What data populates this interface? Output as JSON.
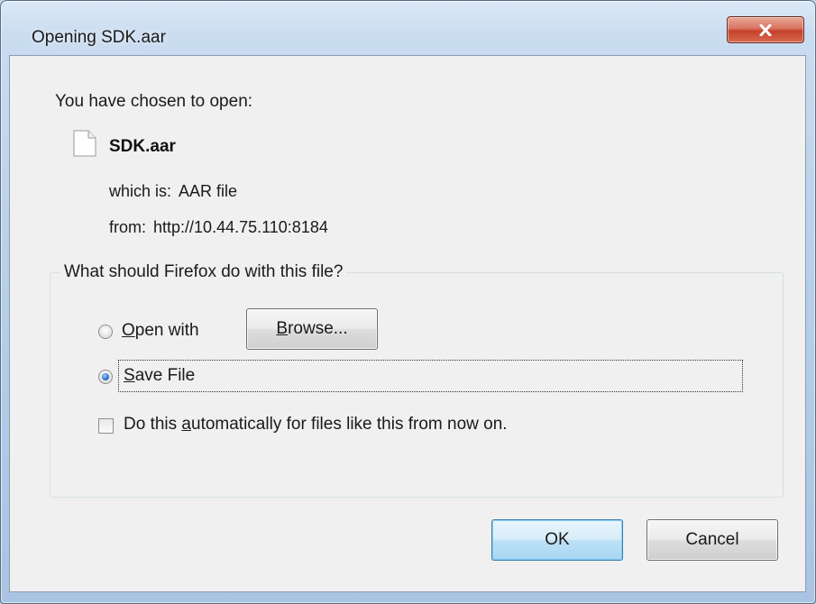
{
  "window": {
    "title": "Opening SDK.aar",
    "close_icon": "close-icon"
  },
  "dialog": {
    "chosen_label": "You have chosen to open:",
    "file_icon": "file-icon",
    "file_name": "SDK.aar",
    "which_is_label": "which is:",
    "which_is_value": "AAR file",
    "from_label": "from:",
    "from_value": "http://10.44.75.110:8184"
  },
  "action_group": {
    "legend": "What should Firefox do with this file?",
    "open_with": {
      "label_accel": "O",
      "label_rest": "pen with",
      "selected": false
    },
    "browse_button": {
      "label_accel": "B",
      "label_rest": "rowse..."
    },
    "save_file": {
      "label_accel": "S",
      "label_rest": "ave File",
      "selected": true
    },
    "auto": {
      "label_pre": "Do this ",
      "label_accel": "a",
      "label_rest": "utomatically for files like this from now on.",
      "checked": false
    }
  },
  "buttons": {
    "ok": "OK",
    "cancel": "Cancel"
  },
  "colors": {
    "frame": "#b9d1ea",
    "client": "#f0f0f0",
    "close_button": "#c4412b",
    "default_button": "#a7d6f2"
  }
}
